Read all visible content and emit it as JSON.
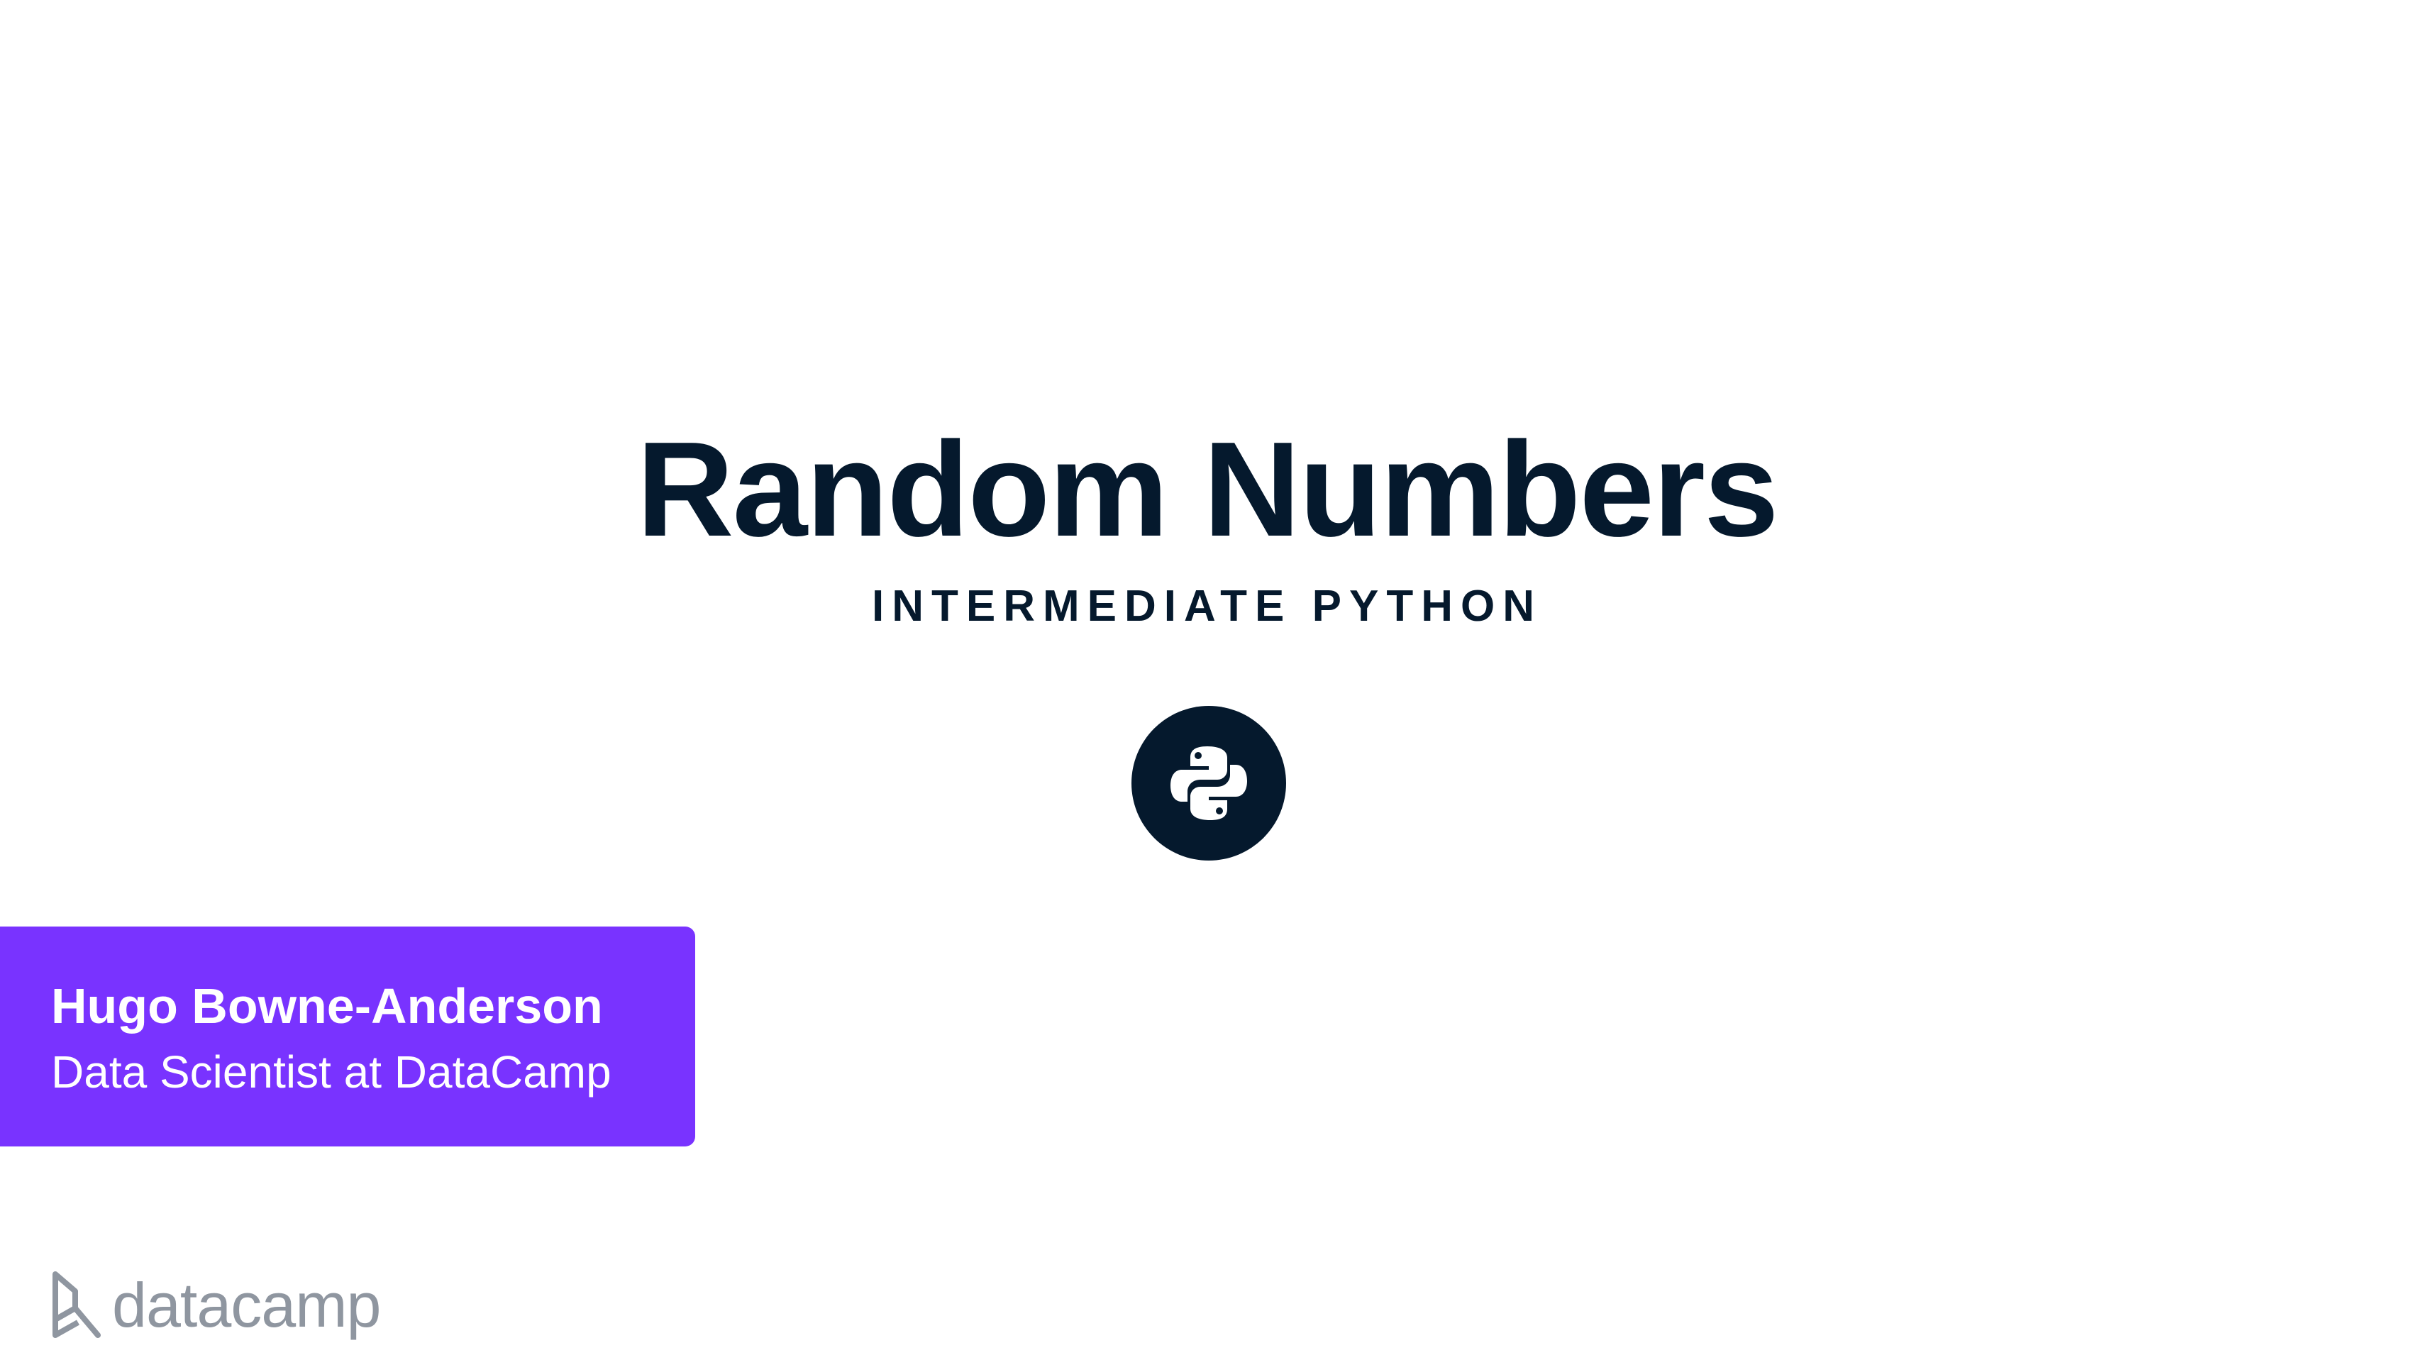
{
  "slide": {
    "title": "Random Numbers",
    "subtitle": "INTERMEDIATE PYTHON",
    "course_icon": "python-logo-icon"
  },
  "author": {
    "name": "Hugo Bowne-Anderson",
    "role": "Data Scientist at DataCamp"
  },
  "brand": {
    "logo_icon": "datacamp-logo-icon",
    "name": "datacamp"
  },
  "colors": {
    "background": "#ffffff",
    "text_dark": "#05192d",
    "accent_purple": "#7933ff",
    "brand_gray": "#8f96a0"
  }
}
